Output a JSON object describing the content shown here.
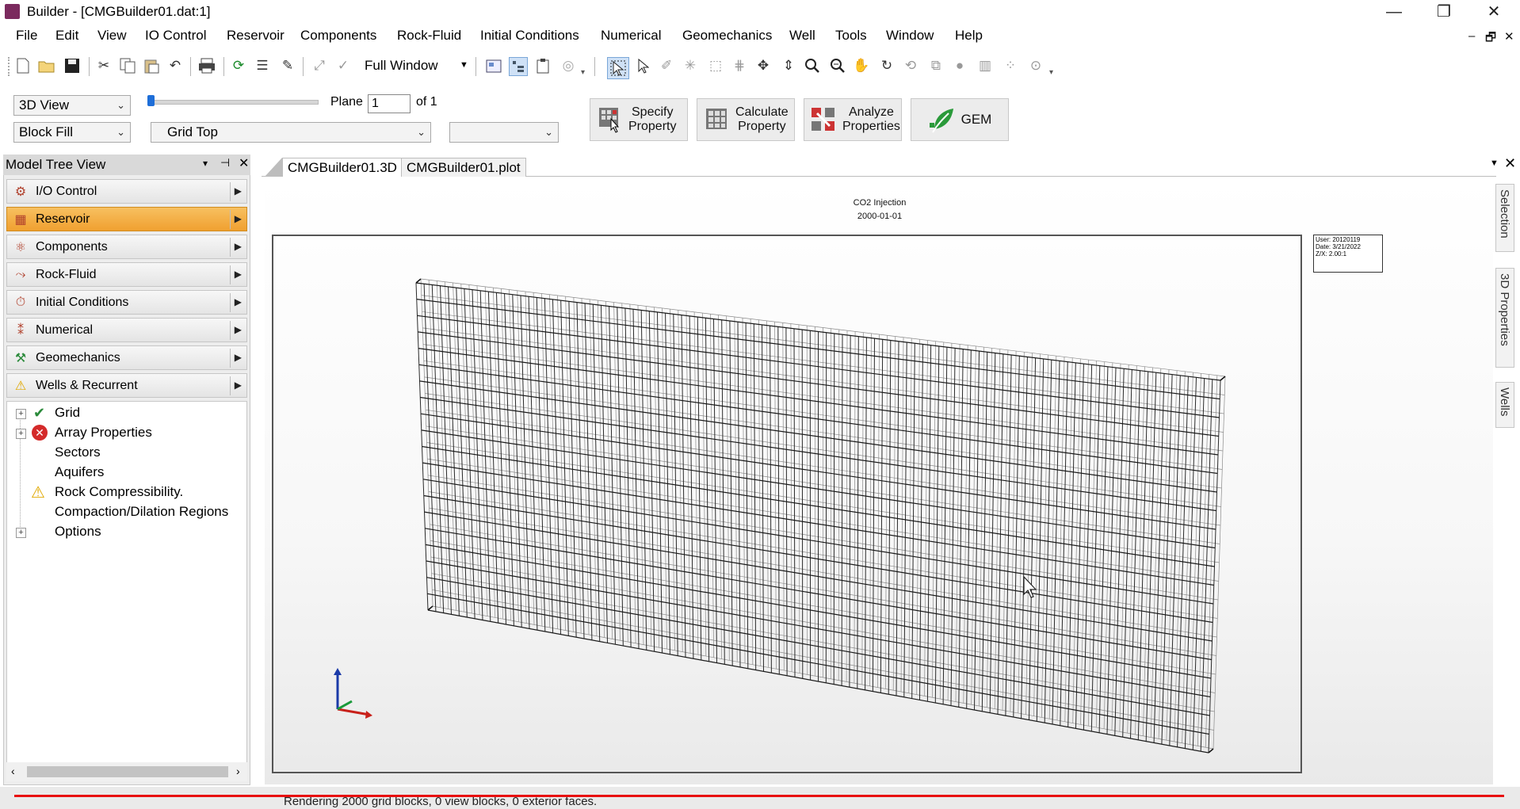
{
  "window": {
    "title": "Builder - [CMGBuilder01.dat:1]",
    "controls": [
      "—",
      "❐",
      "✕"
    ]
  },
  "menu": [
    "File",
    "Edit",
    "View",
    "IO Control",
    "Reservoir",
    "Components",
    "Rock-Fluid",
    "Initial Conditions",
    "Numerical",
    "Geomechanics",
    "Well",
    "Tools",
    "Window",
    "Help"
  ],
  "mdi_controls": [
    "–",
    "🗗",
    "✕"
  ],
  "toolbar": {
    "full_window": "Full Window"
  },
  "view_controls": {
    "view_mode": "3D View",
    "fill_mode": "Block Fill",
    "plane_label": "Plane",
    "plane_value": "1",
    "plane_of": "of 1",
    "grid_select": "Grid Top",
    "extra_select": ""
  },
  "action_buttons": [
    {
      "label1": "Specify",
      "label2": "Property"
    },
    {
      "label1": "Calculate",
      "label2": "Property"
    },
    {
      "label1": "Analyze",
      "label2": "Properties"
    },
    {
      "label1": "GEM",
      "label2": ""
    }
  ],
  "model_tree": {
    "title": "Model Tree View",
    "header_icons": [
      "▾",
      "⊣",
      "✕"
    ],
    "nav": [
      {
        "label": "I/O Control",
        "active": false
      },
      {
        "label": "Reservoir",
        "active": true
      },
      {
        "label": "Components",
        "active": false
      },
      {
        "label": "Rock-Fluid",
        "active": false
      },
      {
        "label": "Initial Conditions",
        "active": false
      },
      {
        "label": "Numerical",
        "active": false
      },
      {
        "label": "Geomechanics",
        "active": false
      },
      {
        "label": "Wells & Recurrent",
        "active": false
      }
    ],
    "tree": [
      "Grid",
      "Array Properties",
      "Sectors",
      "Aquifers",
      "Rock Compressibility.",
      "Compaction/Dilation Regions",
      "Options"
    ]
  },
  "doc_tabs": [
    "CMGBuilder01.3D",
    "CMGBuilder01.plot"
  ],
  "plot": {
    "title": "CO2 Injection",
    "date": "2000-01-01",
    "info": [
      "User: 20120119",
      "Date: 3/21/2022",
      "Z/X: 2.00:1"
    ]
  },
  "side_tabs": [
    "Selection",
    "3D Properties",
    "Wells"
  ],
  "status": {
    "text": "Rendering 2000 grid blocks, 0 view blocks, 0 exterior faces."
  },
  "colors": {
    "active_nav": "#f0a030",
    "status_line": "#e81010"
  }
}
